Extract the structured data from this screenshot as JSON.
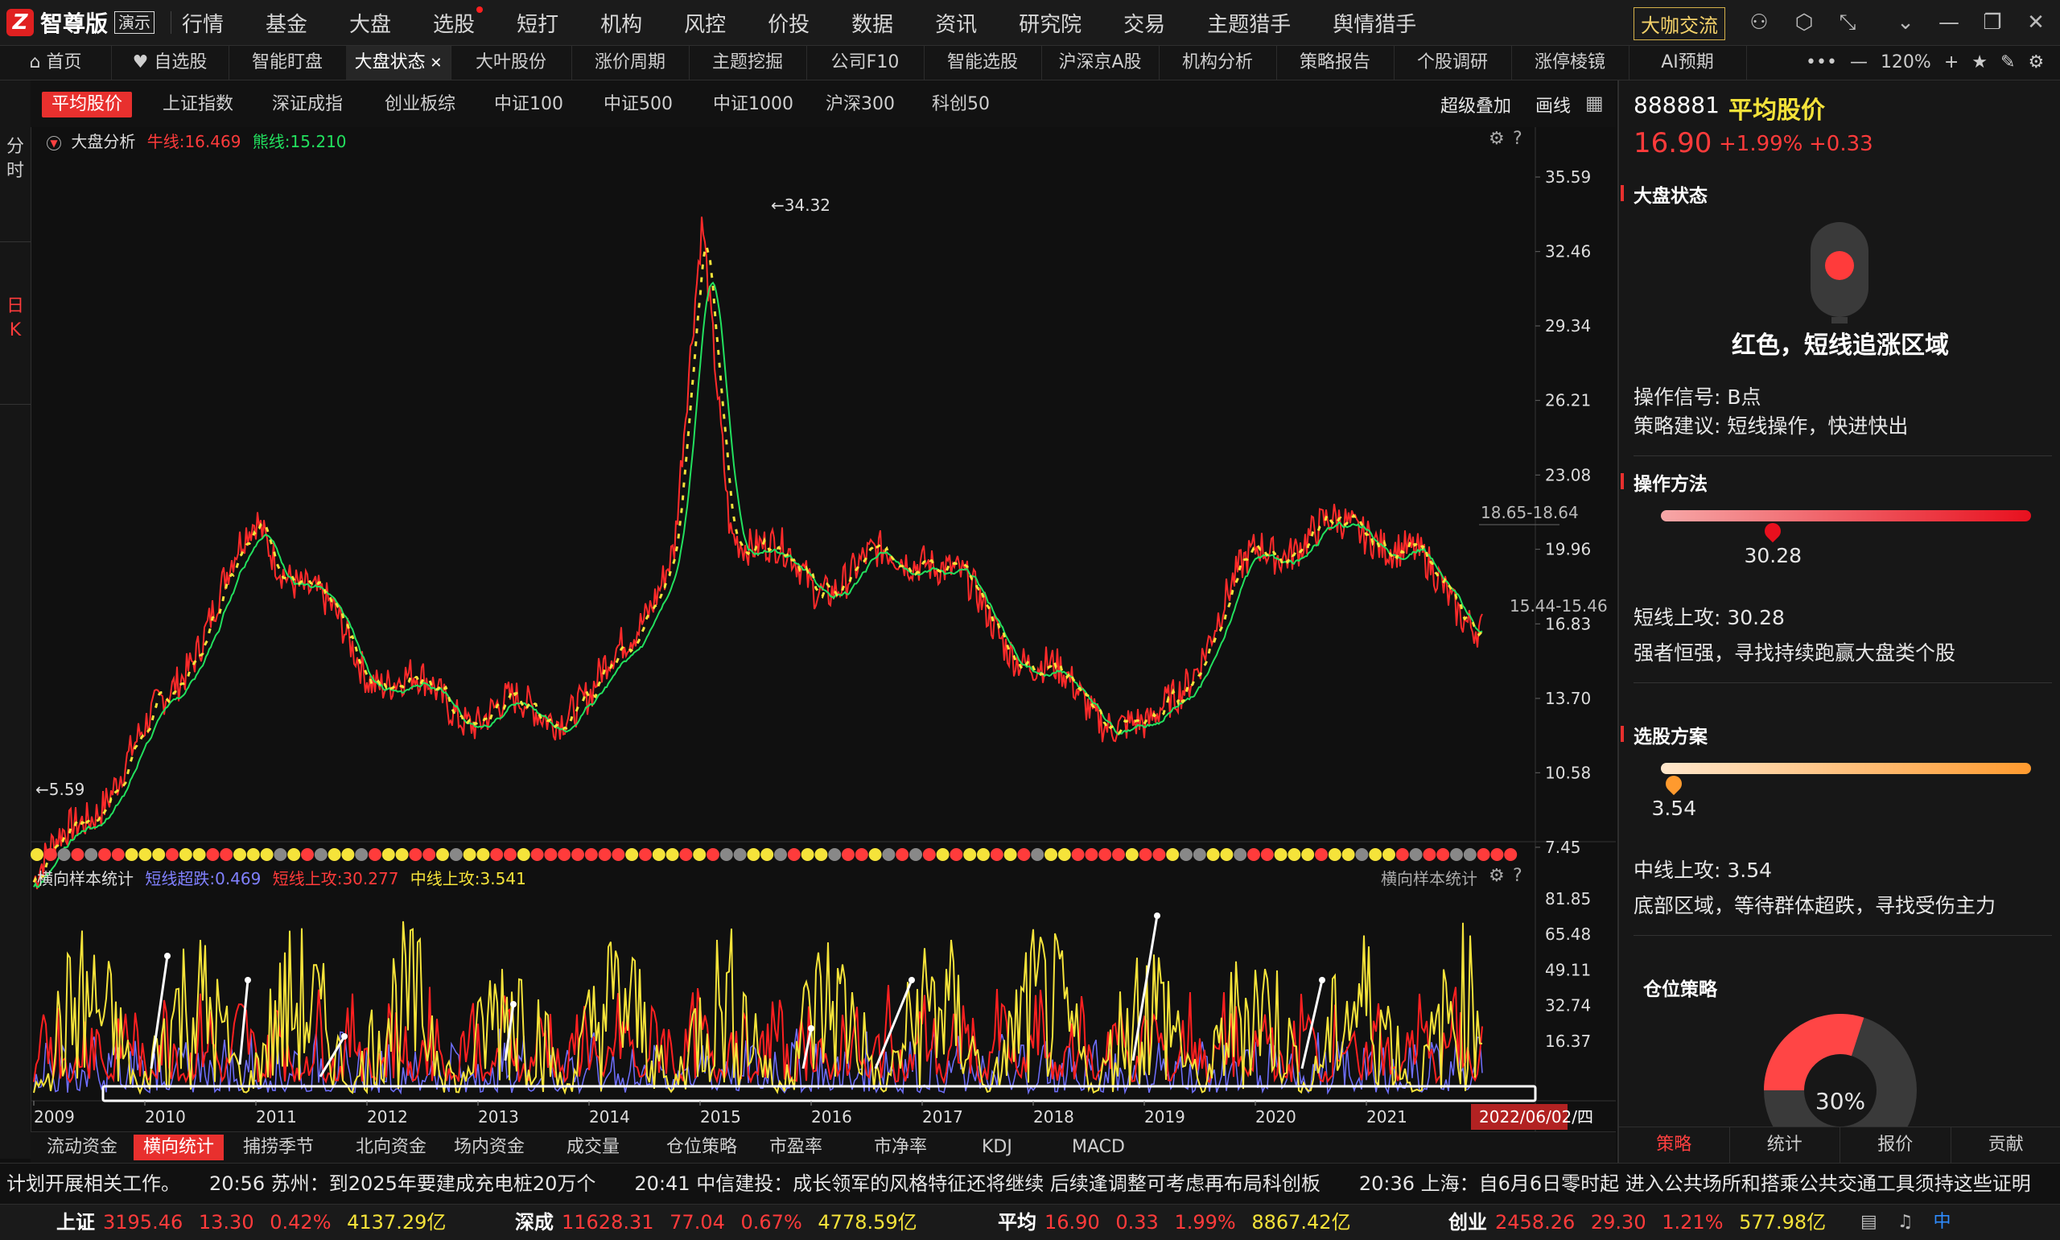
{
  "app": {
    "logo_char": "Z",
    "name": "智尊版",
    "demo_badge": "演示",
    "main_nav": [
      "行情",
      "基金",
      "大盘",
      "选股",
      "短打",
      "机构",
      "风控",
      "价投",
      "数据",
      "资讯",
      "研究院",
      "交易",
      "主题猎手",
      "舆情猎手"
    ],
    "cafe_button": "大咖交流"
  },
  "tabs": [
    {
      "label": "首页"
    },
    {
      "label": "自选股"
    },
    {
      "label": "智能盯盘"
    },
    {
      "label": "大盘状态",
      "active": true
    },
    {
      "label": "大叶股份"
    },
    {
      "label": "涨价周期"
    },
    {
      "label": "主题挖掘"
    },
    {
      "label": "公司F10"
    },
    {
      "label": "智能选股"
    },
    {
      "label": "沪深京A股"
    },
    {
      "label": "机构分析"
    },
    {
      "label": "策略报告"
    },
    {
      "label": "个股调研"
    },
    {
      "label": "涨停棱镜"
    },
    {
      "label": "AI预期"
    }
  ],
  "tab_tools": {
    "zoom": "120%"
  },
  "left_side": {
    "minute": [
      "分",
      "时"
    ],
    "day": [
      "日",
      "K"
    ]
  },
  "sub_tabs": [
    "平均股价",
    "上证指数",
    "深证成指",
    "创业板综",
    "中证100",
    "中证500",
    "中证1000",
    "沪深300",
    "科创50"
  ],
  "sub_tab_tools": {
    "overlay": "超级叠加",
    "draw": "画线"
  },
  "main_chart": {
    "title": "大盘分析",
    "bull_label": "牛线:16.469",
    "bear_label": "熊线:15.210",
    "y_ticks": [
      "35.59",
      "32.46",
      "29.34",
      "26.21",
      "23.08",
      "19.96",
      "16.83",
      "13.70",
      "10.58",
      "7.45"
    ],
    "annotations": {
      "high": "34.32",
      "low": "5.59",
      "level_a": "18.65-18.64",
      "level_b": "15.44-15.46"
    }
  },
  "sub_chart": {
    "title": "横向样本统计",
    "short_oversold": "短线超跌:0.469",
    "short_attack": "短线上攻:30.277",
    "mid_attack": "中线上攻:3.541",
    "right_title": "横向样本统计",
    "y_ticks": [
      "81.85",
      "65.48",
      "49.11",
      "32.74",
      "16.37"
    ]
  },
  "x_axis": {
    "years": [
      "2009",
      "2010",
      "2011",
      "2012",
      "2013",
      "2014",
      "2015",
      "2016",
      "2017",
      "2018",
      "2019",
      "2020",
      "2021"
    ],
    "current_date": "2022/06/02/四"
  },
  "bottom_tabs": [
    "流动资金",
    "横向统计",
    "捕捞季节",
    "北向资金",
    "场内资金",
    "成交量",
    "仓位策略",
    "市盈率",
    "市净率",
    "KDJ",
    "MACD"
  ],
  "right_panel": {
    "code": "888881",
    "name": "平均股价",
    "price": "16.90",
    "change_pct": "+1.99%",
    "change": "+0.33",
    "market_state_title": "大盘状态",
    "light_color": "#ff3b3b",
    "state_text": "红色，短线追涨区域",
    "signal": "操作信号: B点",
    "advice": "策略建议: 短线操作，快进快出",
    "method_title": "操作方法",
    "method_value": "30.28",
    "method_pct": 30.28,
    "short_attack": "短线上攻: 30.28",
    "short_attack_desc": "强者恒强，寻找持续跑赢大盘类个股",
    "pick_title": "选股方案",
    "pick_value": "3.54",
    "pick_pct": 3.54,
    "mid_attack": "中线上攻: 3.54",
    "mid_attack_desc": "底部区域，等待群体超跌，寻找受伤主力",
    "position_title": "仓位策略",
    "position_pct": "30%",
    "position_value": 30,
    "tabs": [
      "策略",
      "统计",
      "报价",
      "贡献"
    ]
  },
  "ticker": "计划开展相关工作。　　20:56 苏州：到2025年要建成充电桩20万个　　20:41 中信建投：成长领军的风格特征还将继续 后续逢调整可考虑再布局科创板　　20:36 上海：自6月6日零时起 进入公共场所和搭乘公共交通工具须持这些证明",
  "status": [
    {
      "name": "上证",
      "value": "3195.46",
      "chg": "13.30",
      "pct": "0.42%",
      "amount": "4137.29亿"
    },
    {
      "name": "深成",
      "value": "11628.31",
      "chg": "77.04",
      "pct": "0.67%",
      "amount": "4778.59亿"
    },
    {
      "name": "平均",
      "value": "16.90",
      "chg": "0.33",
      "pct": "1.99%",
      "amount": "8867.42亿"
    },
    {
      "name": "创业",
      "value": "2458.26",
      "chg": "29.30",
      "pct": "1.21%",
      "amount": "577.98亿"
    }
  ],
  "colors": {
    "up": "#ff3b3b",
    "down": "#22c55e",
    "accent": "#e8302e",
    "yellow": "#f5e33a",
    "bg": "#101010"
  },
  "chart_data": {
    "type": "line",
    "title": "大盘分析",
    "x": [
      "2009",
      "2010",
      "2011",
      "2012",
      "2013",
      "2014",
      "2015",
      "2016",
      "2017",
      "2018",
      "2019",
      "2020",
      "2021",
      "2022/06/02"
    ],
    "series": [
      {
        "values": [
          6.0,
          12.0,
          21.0,
          15.0,
          13.0,
          13.5,
          22.0,
          18.5,
          20.0,
          15.0,
          12.0,
          20.0,
          21.0,
          16.9
        ]
      }
    ],
    "ylim": [
      5.59,
      35.59
    ]
  }
}
